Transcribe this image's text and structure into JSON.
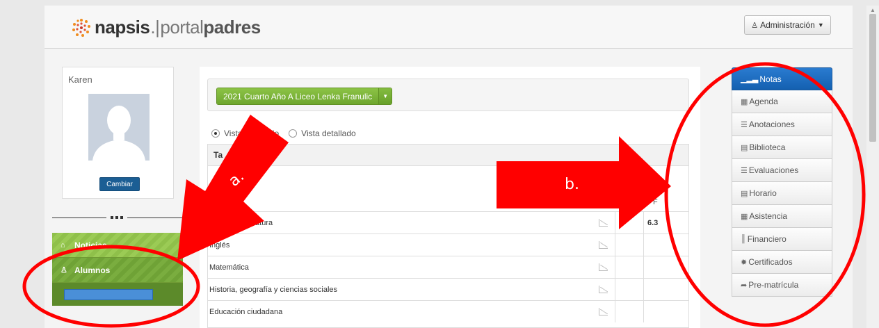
{
  "header": {
    "logo": {
      "brand": "napsis",
      "separator": ".|",
      "portal": "portal",
      "audience": "padres"
    },
    "admin_label": "Administración",
    "admin_icon": "user-icon"
  },
  "profile": {
    "name": "Karen",
    "change_label": "Cambiar"
  },
  "left_nav": {
    "items": [
      {
        "label": "Noticias",
        "icon": "home-icon"
      },
      {
        "label": "Alumnos",
        "icon": "user-icon"
      }
    ]
  },
  "content": {
    "year_selector": "2021 Cuarto Año A Liceo Lenka Franulic",
    "view_options": [
      {
        "label": "Vista resumido",
        "selected": true
      },
      {
        "label": "Vista detallado",
        "selected": false
      }
    ],
    "table": {
      "header": "Ta",
      "final_column": "F",
      "rows": [
        {
          "subject": "Lengua y literatura",
          "grade": "6.3"
        },
        {
          "subject": "Inglés",
          "grade": ""
        },
        {
          "subject": "Matemática",
          "grade": ""
        },
        {
          "subject": "Historia, geografía y ciencias sociales",
          "grade": ""
        },
        {
          "subject": "Educación ciudadana",
          "grade": ""
        }
      ]
    }
  },
  "side_menu": {
    "items": [
      {
        "label": "Notas",
        "icon": "bar-chart-icon",
        "active": true
      },
      {
        "label": "Agenda",
        "icon": "grid-icon",
        "active": false
      },
      {
        "label": "Anotaciones",
        "icon": "list-icon",
        "active": false
      },
      {
        "label": "Biblioteca",
        "icon": "book-icon",
        "active": false
      },
      {
        "label": "Evaluaciones",
        "icon": "list-icon",
        "active": false
      },
      {
        "label": "Horario",
        "icon": "table-icon",
        "active": false
      },
      {
        "label": "Asistencia",
        "icon": "calendar-icon",
        "active": false
      },
      {
        "label": "Financiero",
        "icon": "barcode-icon",
        "active": false
      },
      {
        "label": "Certificados",
        "icon": "certificate-icon",
        "active": false
      },
      {
        "label": "Pre-matrícula",
        "icon": "share-icon",
        "active": false
      }
    ]
  },
  "annotations": {
    "a": "a.",
    "b": "b."
  },
  "colors": {
    "accent_green": "#8cc346",
    "active_blue": "#1f6fc0",
    "annotation_red": "#ff0000"
  }
}
